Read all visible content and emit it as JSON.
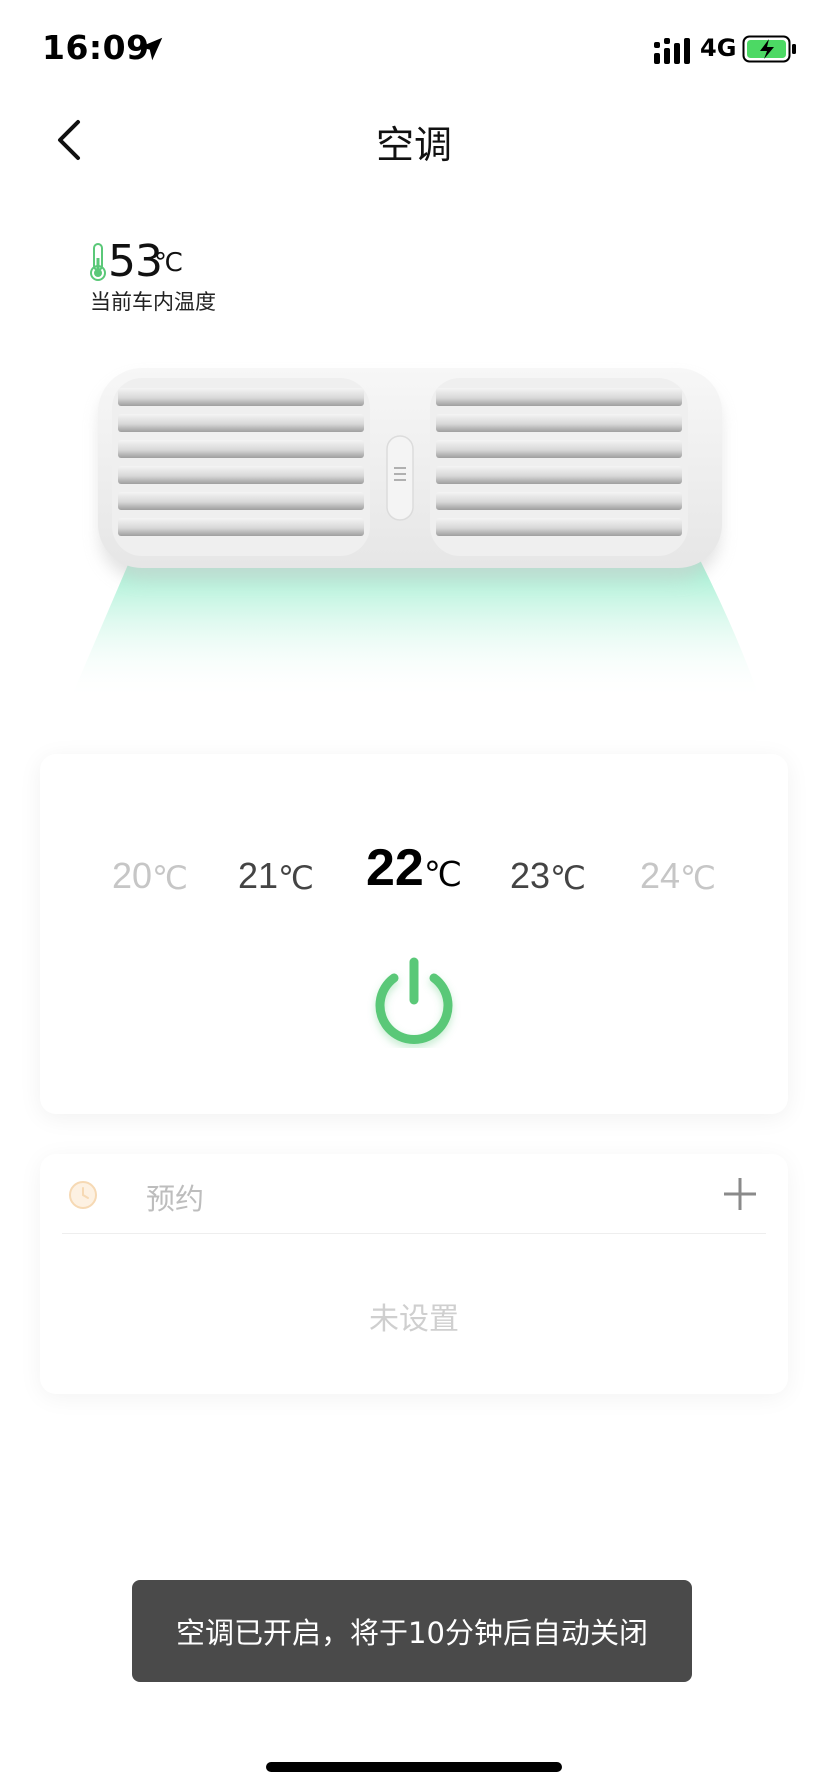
{
  "status_bar": {
    "time": "16:09",
    "network": "4G",
    "battery_color": "#4cd964"
  },
  "nav": {
    "title": "空调"
  },
  "interior": {
    "temperature": "53",
    "unit": "℃",
    "label": "当前车内温度"
  },
  "temperature_selector": {
    "options": [
      {
        "value": "20",
        "unit": "℃"
      },
      {
        "value": "21",
        "unit": "℃"
      },
      {
        "value": "22",
        "unit": "℃"
      },
      {
        "value": "23",
        "unit": "℃"
      },
      {
        "value": "24",
        "unit": "℃"
      }
    ],
    "selected": "22",
    "power_color": "#5ac878"
  },
  "reservation": {
    "label": "预约",
    "empty_text": "未设置"
  },
  "toast": {
    "message": "空调已开启，将于10分钟后自动关闭"
  },
  "colors": {
    "accent_green": "#5ac878",
    "airflow": "#a8f0d4"
  }
}
